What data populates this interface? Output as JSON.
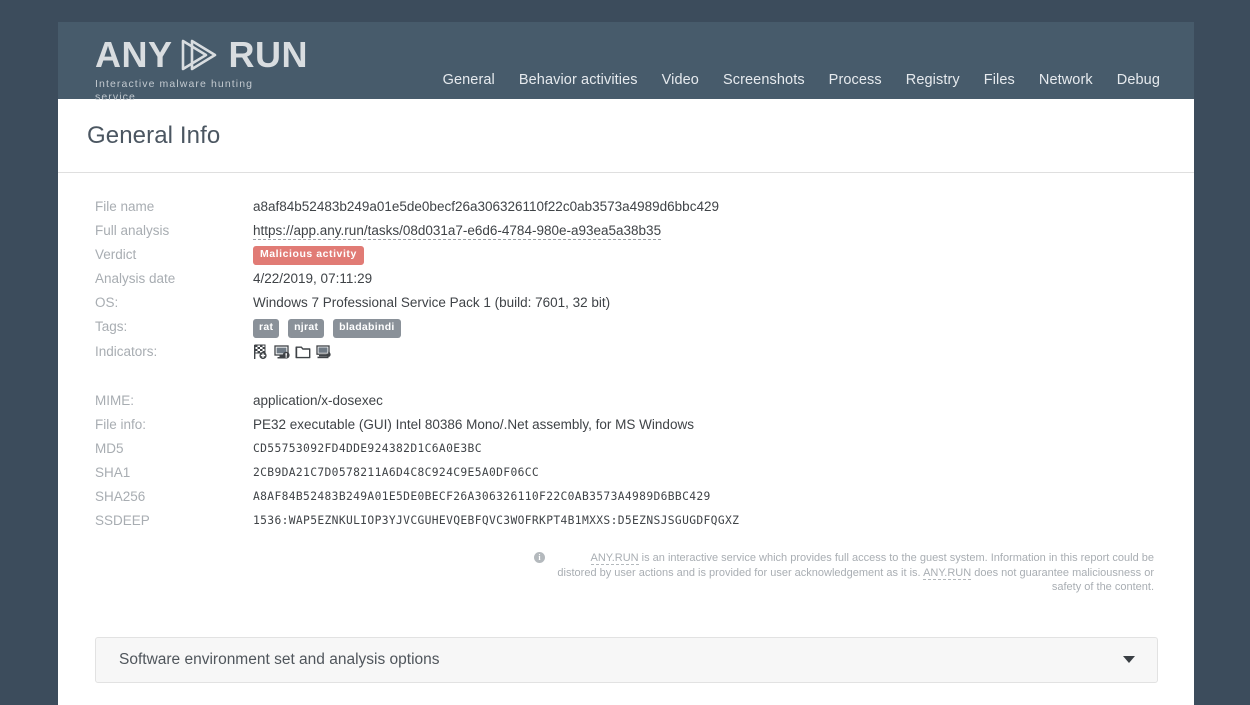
{
  "brand": {
    "name_left": "ANY",
    "name_right": "RUN",
    "mark": "play-triangle-icon",
    "tagline": "Interactive malware hunting service"
  },
  "nav": {
    "items": [
      {
        "label": "General",
        "name": "nav-general"
      },
      {
        "label": "Behavior activities",
        "name": "nav-behavior-activities"
      },
      {
        "label": "Video",
        "name": "nav-video"
      },
      {
        "label": "Screenshots",
        "name": "nav-screenshots"
      },
      {
        "label": "Process",
        "name": "nav-process"
      },
      {
        "label": "Registry",
        "name": "nav-registry"
      },
      {
        "label": "Files",
        "name": "nav-files"
      },
      {
        "label": "Network",
        "name": "nav-network"
      },
      {
        "label": "Debug",
        "name": "nav-debug"
      }
    ]
  },
  "page": {
    "title": "General Info"
  },
  "general_info": {
    "file_name_label": "File name",
    "file_name_value": "a8af84b52483b249a01e5de0becf26a306326110f22c0ab3573a4989d6bbc429",
    "full_analysis_label": "Full analysis",
    "full_analysis_value": "https://app.any.run/tasks/08d031a7-e6d6-4784-980e-a93ea5a38b35",
    "verdict_label": "Verdict",
    "verdict_value": "Malicious activity",
    "analysis_date_label": "Analysis date",
    "analysis_date_value": "4/22/2019, 07:11:29",
    "os_label": "OS:",
    "os_value": "Windows 7 Professional Service Pack 1 (build: 7601, 32 bit)",
    "tags_label": "Tags:",
    "tags": [
      "rat",
      "njrat",
      "bladabindi"
    ],
    "indicators_label": "Indicators:",
    "indicators": [
      "checkered-flag-icon",
      "monitor-alert-icon",
      "folder-icon",
      "network-fire-icon"
    ]
  },
  "file_details": {
    "mime_label": "MIME:",
    "mime_value": "application/x-dosexec",
    "file_info_label": "File info:",
    "file_info_value": "PE32 executable (GUI) Intel 80386 Mono/.Net assembly, for MS Windows",
    "md5_label": "MD5",
    "md5_value": "CD55753092FD4DDE924382D1C6A0E3BC",
    "sha1_label": "SHA1",
    "sha1_value": "2CB9DA21C7D0578211A6D4C8C924C9E5A0DF06CC",
    "sha256_label": "SHA256",
    "sha256_value": "A8AF84B52483B249A01E5DE0BECF26A306326110F22C0AB3573A4989D6BBC429",
    "ssdeep_label": "SSDEEP",
    "ssdeep_value": "1536:WAP5EZNKULIOP3YJVCGUHEVQEBFQVC3WOFRKPT4B1MXXS:D5EZNSJSGUGDFQGXZ"
  },
  "disclaimer": {
    "icon": "info-circle-icon",
    "brand_1": "ANY.RUN",
    "text_1": " is an interactive service which provides full access to the guest system. Information in this report could be distored by user actions and is provided for user acknowledgement as it is. ",
    "brand_2": "ANY.RUN",
    "text_2": " does not guarantee maliciousness or safety of the content."
  },
  "accordion": {
    "title": "Software environment set and analysis options",
    "chevron": "chevron-down-icon"
  },
  "colors": {
    "page_background": "#3c4c5c",
    "header_bar": "#475b6b",
    "verdict_badge": "#e17b75",
    "tag_badge": "#8a9199",
    "label_text": "#a8adb2",
    "value_text": "#3f4347",
    "accordion_background": "#f7f7f7"
  }
}
